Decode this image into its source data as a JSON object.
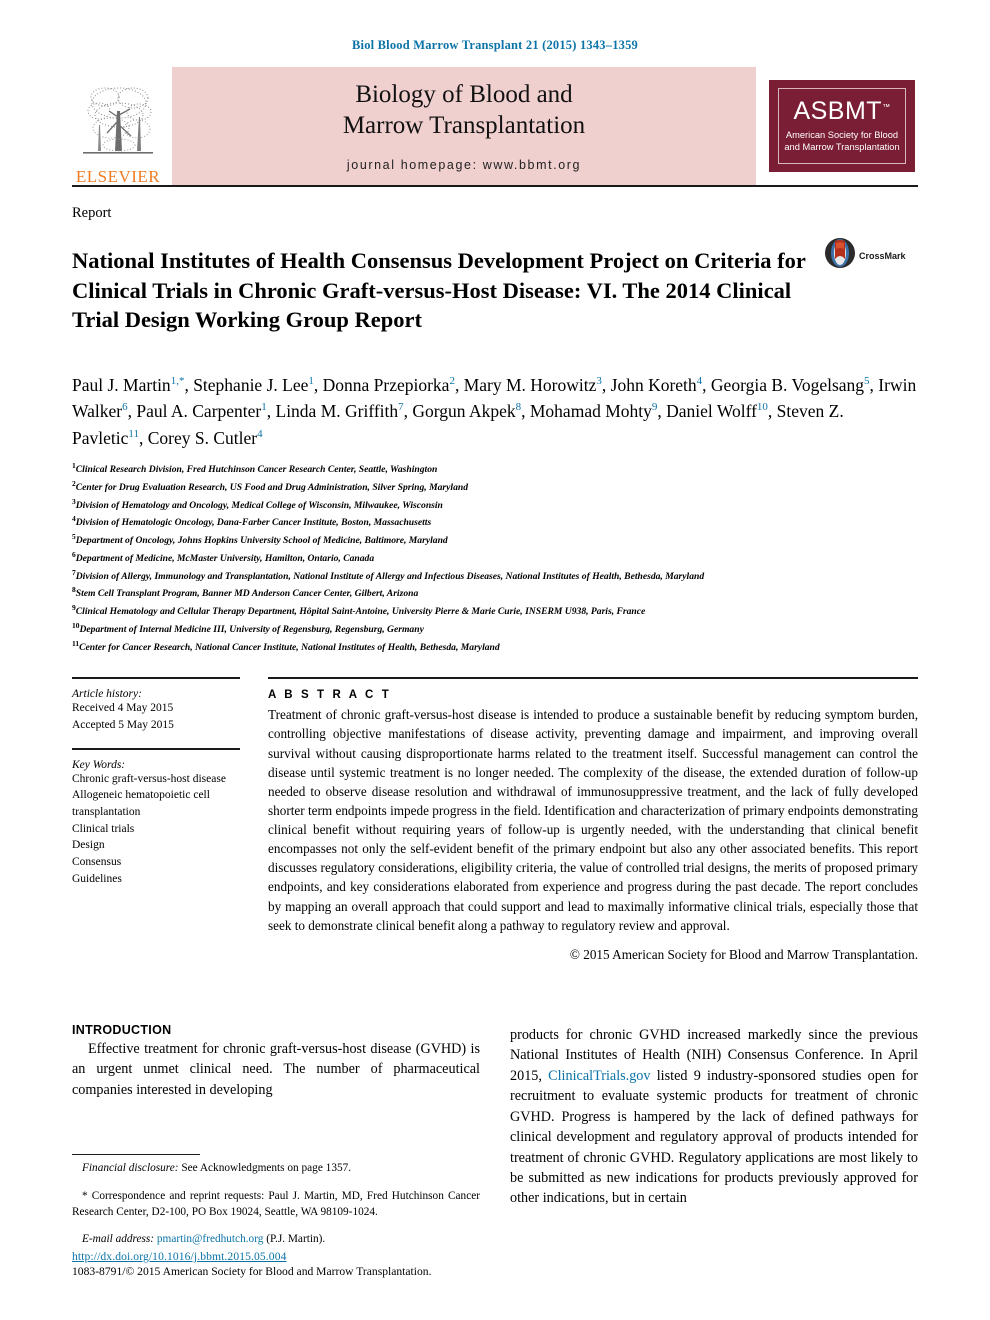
{
  "running_head": "Biol Blood Marrow Transplant 21 (2015) 1343–1359",
  "masthead": {
    "publisher_name": "ELSEVIER",
    "publisher_logo": "elsevier-tree-logo",
    "journal_title_line1": "Biology of Blood and",
    "journal_title_line2": "Marrow Transplantation",
    "journal_homepage": "journal homepage: www.bbmt.org",
    "society_acronym": "ASBMT",
    "society_tm": "™",
    "society_name_line1": "American Society for Blood",
    "society_name_line2": "and Marrow Transplantation",
    "band_color": "#f0cfcf",
    "society_color": "#7a1e35",
    "elsevier_color": "#f07c23"
  },
  "article": {
    "type_label": "Report",
    "title": "National Institutes of Health Consensus Development Project on Criteria for Clinical Trials in Chronic Graft-versus-Host Disease: VI. The 2014 Clinical Trial Design Working Group Report",
    "crossmark_label": "CrossMark",
    "authors": [
      {
        "name": "Paul J. Martin",
        "sup": "1,*"
      },
      {
        "name": "Stephanie J. Lee",
        "sup": "1"
      },
      {
        "name": "Donna Przepiorka",
        "sup": "2"
      },
      {
        "name": "Mary M. Horowitz",
        "sup": "3"
      },
      {
        "name": "John Koreth",
        "sup": "4"
      },
      {
        "name": "Georgia B. Vogelsang",
        "sup": "5"
      },
      {
        "name": "Irwin Walker",
        "sup": "6"
      },
      {
        "name": "Paul A. Carpenter",
        "sup": "1"
      },
      {
        "name": "Linda M. Griffith",
        "sup": "7"
      },
      {
        "name": "Gorgun Akpek",
        "sup": "8"
      },
      {
        "name": "Mohamad Mohty",
        "sup": "9"
      },
      {
        "name": "Daniel Wolff",
        "sup": "10"
      },
      {
        "name": "Steven Z. Pavletic",
        "sup": "11"
      },
      {
        "name": "Corey S. Cutler",
        "sup": "4"
      }
    ],
    "affiliations": [
      {
        "num": "1",
        "text": "Clinical Research Division, Fred Hutchinson Cancer Research Center, Seattle, Washington"
      },
      {
        "num": "2",
        "text": "Center for Drug Evaluation Research, US Food and Drug Administration, Silver Spring, Maryland"
      },
      {
        "num": "3",
        "text": "Division of Hematology and Oncology, Medical College of Wisconsin, Milwaukee, Wisconsin"
      },
      {
        "num": "4",
        "text": "Division of Hematologic Oncology, Dana-Farber Cancer Institute, Boston, Massachusetts"
      },
      {
        "num": "5",
        "text": "Department of Oncology, Johns Hopkins University School of Medicine, Baltimore, Maryland"
      },
      {
        "num": "6",
        "text": "Department of Medicine, McMaster University, Hamilton, Ontario, Canada"
      },
      {
        "num": "7",
        "text": "Division of Allergy, Immunology and Transplantation, National Institute of Allergy and Infectious Diseases, National Institutes of Health, Bethesda, Maryland"
      },
      {
        "num": "8",
        "text": "Stem Cell Transplant Program, Banner MD Anderson Cancer Center, Gilbert, Arizona"
      },
      {
        "num": "9",
        "text": "Clinical Hematology and Cellular Therapy Department, Hôpital Saint-Antoine, University Pierre & Marie Curie, INSERM U938, Paris, France"
      },
      {
        "num": "10",
        "text": "Department of Internal Medicine III, University of Regensburg, Regensburg, Germany"
      },
      {
        "num": "11",
        "text": "Center for Cancer Research, National Cancer Institute, National Institutes of Health, Bethesda, Maryland"
      }
    ]
  },
  "sidebar": {
    "history_label": "Article history:",
    "history_lines": [
      "Received 4 May 2015",
      "Accepted 5 May 2015"
    ],
    "keywords_label": "Key Words:",
    "keywords": [
      "Chronic graft-versus-host disease",
      "Allogeneic hematopoietic cell transplantation",
      "Clinical trials",
      "Design",
      "Consensus",
      "Guidelines"
    ]
  },
  "abstract": {
    "label": "A B S T R A C T",
    "text": "Treatment of chronic graft-versus-host disease is intended to produce a sustainable benefit by reducing symptom burden, controlling objective manifestations of disease activity, preventing damage and impairment, and improving overall survival without causing disproportionate harms related to the treatment itself. Successful management can control the disease until systemic treatment is no longer needed. The complexity of the disease, the extended duration of follow-up needed to observe disease resolution and withdrawal of immunosuppressive treatment, and the lack of fully developed shorter term endpoints impede progress in the field. Identification and characterization of primary endpoints demonstrating clinical benefit without requiring years of follow-up is urgently needed, with the understanding that clinical benefit encompasses not only the self-evident benefit of the primary endpoint but also any other associated benefits. This report discusses regulatory considerations, eligibility criteria, the value of controlled trial designs, the merits of proposed primary endpoints, and key considerations elaborated from experience and progress during the past decade. The report concludes by mapping an overall approach that could support and lead to maximally informative clinical trials, especially those that seek to demonstrate clinical benefit along a pathway to regulatory review and approval.",
    "copyright": "© 2015 American Society for Blood and Marrow Transplantation."
  },
  "body": {
    "heading": "INTRODUCTION",
    "left_paragraph": "Effective treatment for chronic graft-versus-host disease (GVHD) is an urgent unmet clinical need. The number of pharmaceutical companies interested in developing",
    "right_paragraph_part1": "products for chronic GVHD increased markedly since the previous National Institutes of Health (NIH) Consensus Conference. In April 2015, ",
    "right_link": "ClinicalTrials.gov",
    "right_paragraph_part2": " listed 9 industry-sponsored studies open for recruitment to evaluate systemic products for treatment of chronic GVHD. Progress is hampered by the lack of defined pathways for clinical development and regulatory approval of products intended for treatment of chronic GVHD. Regulatory applications are most likely to be submitted as new indications for products previously approved for other indications, but in certain"
  },
  "footnotes": {
    "financial_label": "Financial disclosure:",
    "financial_text": " See Acknowledgments on page 1357.",
    "correspondence_text": "* Correspondence and reprint requests: Paul J. Martin, MD, Fred Hutchinson Cancer Research Center, D2-100, PO Box 19024, Seattle, WA 98109-1024.",
    "email_label": "E-mail address:",
    "email_link": "pmartin@fredhutch.org",
    "email_suffix": " (P.J. Martin)."
  },
  "page_footer": {
    "doi": "http://dx.doi.org/10.1016/j.bbmt.2015.05.004",
    "issn_line": "1083-8791/© 2015 American Society for Blood and Marrow Transplantation."
  }
}
